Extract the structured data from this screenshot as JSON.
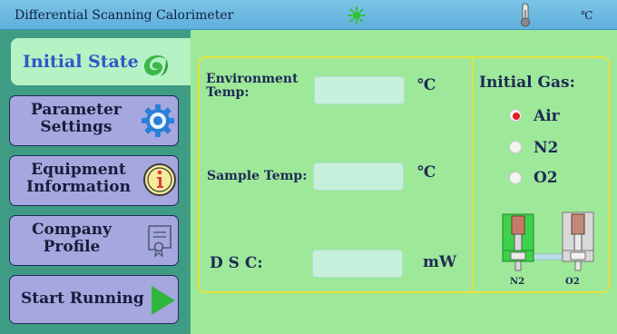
{
  "window": {
    "title": "Differential Scanning Calorimeter",
    "temp_unit": "℃"
  },
  "sidebar": {
    "active": {
      "label": "Initial State"
    },
    "items": [
      {
        "label": "Parameter\nSettings"
      },
      {
        "label": "Equipment\nInformation"
      },
      {
        "label": "Company\nProfile"
      },
      {
        "label": "Start Running"
      }
    ]
  },
  "main": {
    "fields": [
      {
        "label": "Environment\nTemp:",
        "value": "",
        "unit": "℃"
      },
      {
        "label": "Sample Temp:",
        "value": "",
        "unit": "℃"
      },
      {
        "label": "D S C:",
        "value": "",
        "unit": "mW"
      }
    ],
    "gas": {
      "title": "Initial Gas:",
      "options": [
        {
          "label": "Air",
          "selected": true
        },
        {
          "label": "N2",
          "selected": false
        },
        {
          "label": "O2",
          "selected": false
        }
      ],
      "valves": [
        {
          "caption": "N2"
        },
        {
          "caption": "O2"
        }
      ]
    }
  },
  "colors": {
    "background": "#9ee89a",
    "sidebar": "#3f9c84",
    "active_tab": "#b5f2c4",
    "nav_button": "#a6a7de",
    "panel_border": "#e5e23c",
    "radio_selected": "#e02020",
    "titlebar": "#6bb8e0"
  },
  "icons": {
    "status": "green-sun-icon",
    "thermometer": "thermometer-icon",
    "initial_state": "green-swirl-icon",
    "parameter_settings": "gear-icon",
    "equipment_information": "info-icon",
    "company_profile": "certificate-icon",
    "start_running": "play-icon"
  }
}
